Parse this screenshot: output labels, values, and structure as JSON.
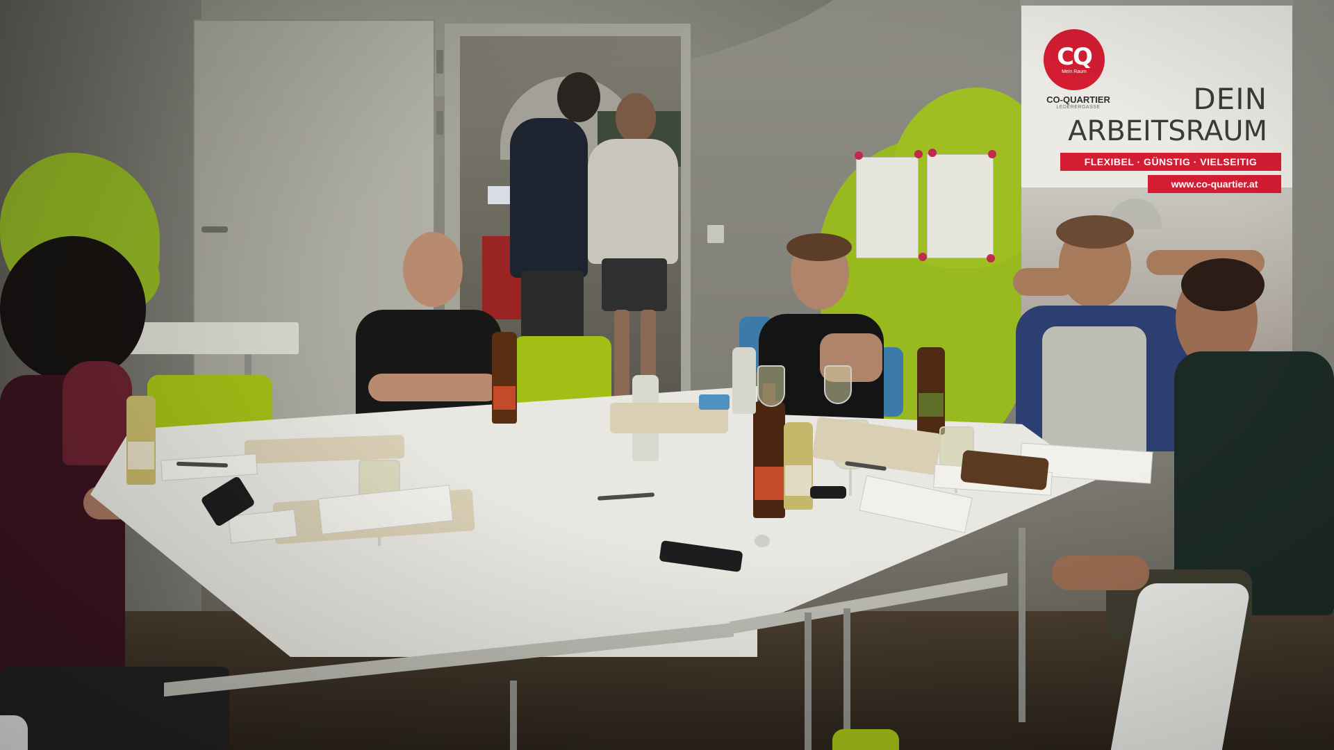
{
  "banner": {
    "logo_mark": "CQ",
    "logo_sub": "Mein Raum",
    "brand": "CO-QUARTIER",
    "brand_sub": "LEDERERGASSE",
    "headline_line1": "DEIN",
    "headline_line2": "ARBEITSRAUM",
    "tagline": "FLEXIBEL · GÜNSTIG · VIELSEITIG",
    "url": "www.co-quartier.at"
  },
  "colors": {
    "brand_red": "#d41d33",
    "lime": "#98ba1e",
    "table": "#e8e7e1"
  }
}
